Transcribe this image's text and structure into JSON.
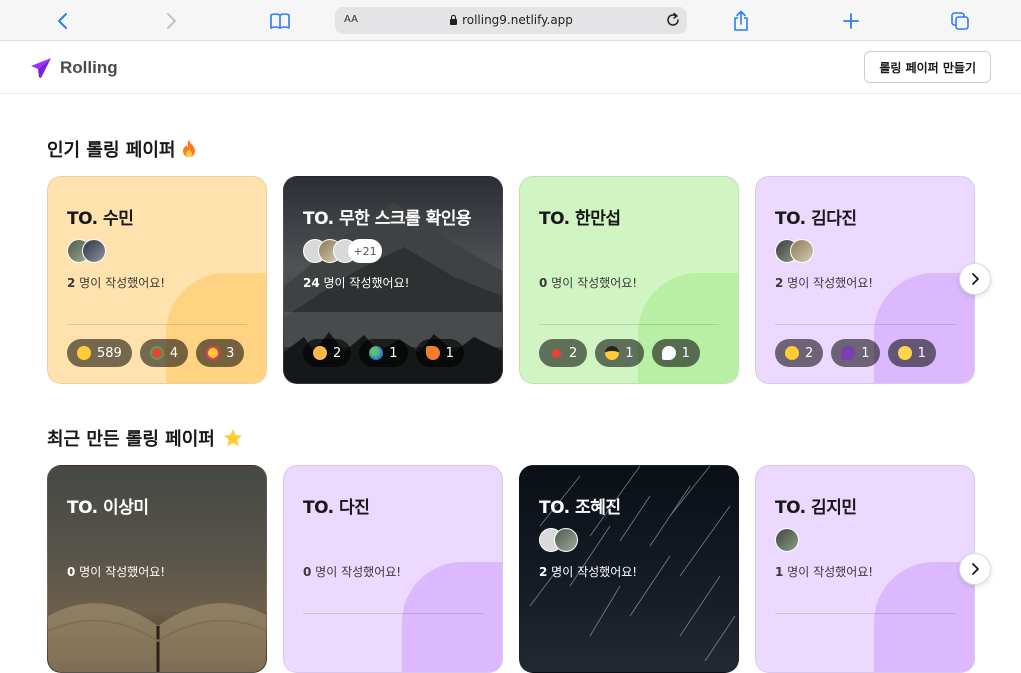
{
  "browser": {
    "url": "rolling9.netlify.app",
    "text_size_label": "AA"
  },
  "header": {
    "logo_text": "Rolling",
    "make_button": "롤링 페이퍼 만들기"
  },
  "popular": {
    "title": "인기 롤링 페이퍼",
    "cards": [
      {
        "to": "TO. 수민",
        "count": "2",
        "suffix": " 명이 작성했어요!",
        "theme": "orange",
        "reactions": [
          {
            "emoji": "grinning-face",
            "count": "589"
          },
          {
            "emoji": "watermelon",
            "count": "4"
          },
          {
            "emoji": "heart-eyes",
            "count": "3"
          }
        ]
      },
      {
        "to": "TO. 무한 스크롤 확인용",
        "count": "24",
        "suffix": " 명이 작성했어요!",
        "more": "+21",
        "theme": "mountain-image",
        "reactions": [
          {
            "emoji": "face-with-hand",
            "count": "2"
          },
          {
            "emoji": "globe",
            "count": "1"
          },
          {
            "emoji": "carrot",
            "count": "1"
          }
        ]
      },
      {
        "to": "TO. 한만섭",
        "count": "0",
        "suffix": " 명이 작성했어요!",
        "theme": "green",
        "reactions": [
          {
            "emoji": "pin",
            "count": "2"
          },
          {
            "emoji": "sunglasses-face",
            "count": "1"
          },
          {
            "emoji": "speech-bubble",
            "count": "1"
          }
        ]
      },
      {
        "to": "TO. 김다진",
        "count": "2",
        "suffix": " 명이 작성했어요!",
        "theme": "purple",
        "reactions": [
          {
            "emoji": "grinning-face",
            "count": "2"
          },
          {
            "emoji": "eggplant",
            "count": "1"
          },
          {
            "emoji": "smiling-face",
            "count": "1"
          }
        ]
      }
    ]
  },
  "recent": {
    "title": "최근 만든 롤링 페이퍼",
    "cards": [
      {
        "to": "TO. 이상미",
        "count": "0",
        "suffix": " 명이 작성했어요!",
        "theme": "book-image"
      },
      {
        "to": "TO. 다진",
        "count": "0",
        "suffix": " 명이 작성했어요!",
        "theme": "purple"
      },
      {
        "to": "TO. 조혜진",
        "count": "2",
        "suffix": " 명이 작성했어요!",
        "theme": "stars-image"
      },
      {
        "to": "TO. 김지민",
        "count": "1",
        "suffix": " 명이 작성했어요!",
        "theme": "purple"
      }
    ]
  },
  "colors": {
    "orange": "#ffe2ad",
    "green": "#d0f5c3",
    "purple": "#ecd9ff",
    "brand": "#9935ff"
  }
}
